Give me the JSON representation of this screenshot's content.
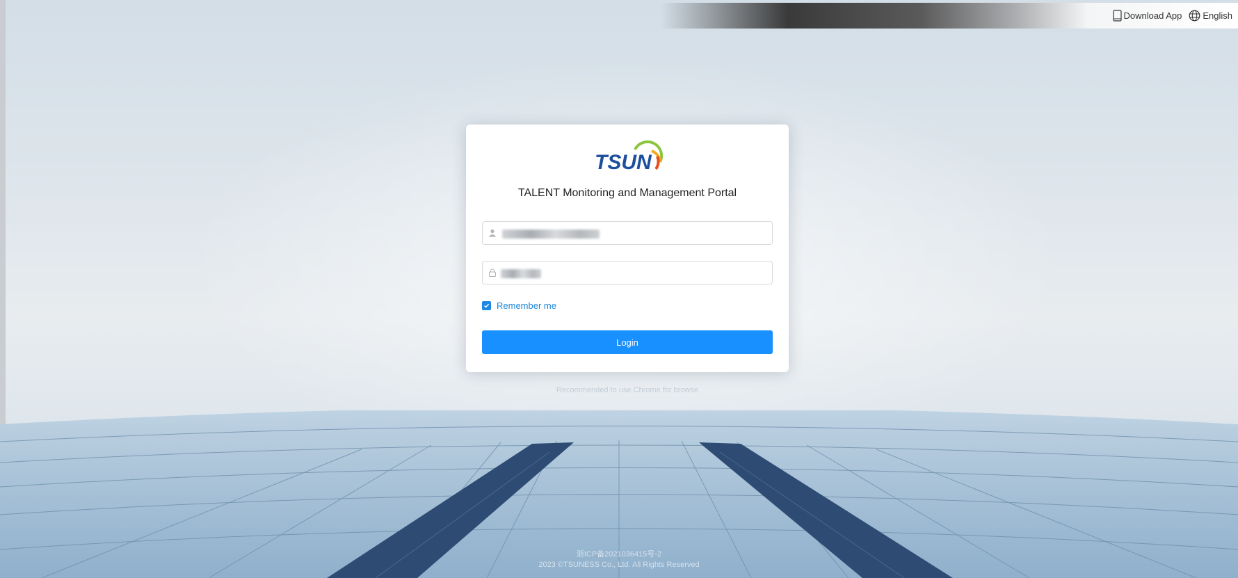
{
  "header": {
    "download_app_label": "Download App",
    "language_label": "English",
    "download_icon": "mobile-phone-icon",
    "language_icon": "globe-icon"
  },
  "login": {
    "logo_text": "TSUN",
    "title": "TALENT Monitoring and Management Portal",
    "username_icon": "user-icon",
    "password_icon": "lock-icon",
    "remember_label": "Remember me",
    "remember_checked": true,
    "login_label": "Login",
    "primary_color": "#1890ff"
  },
  "browser_note": "Recommended to use Chrome for browse",
  "footer": {
    "icp": "浙ICP备2021036415号-2",
    "copyright": "2023 ©TSUNESS Co., Ltd. All Rights Reserved"
  }
}
